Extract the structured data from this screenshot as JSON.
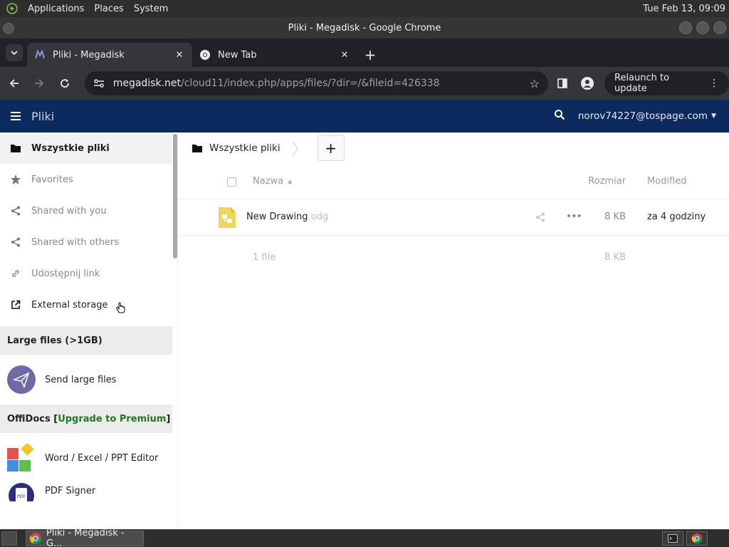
{
  "os_panel": {
    "menus": [
      "Applications",
      "Places",
      "System"
    ],
    "clock": "Tue Feb 13, 09:09"
  },
  "window": {
    "title": "Pliki - Megadisk - Google Chrome"
  },
  "tabs": [
    {
      "title": "Pliki - Megadisk",
      "active": true
    },
    {
      "title": "New Tab",
      "active": false
    }
  ],
  "toolbar": {
    "url_host": "megadisk.net",
    "url_path": "/cloud11/index.php/apps/files/?dir=/&fileid=426338",
    "relaunch_label": "Relaunch to update"
  },
  "app_header": {
    "app_name": "Pliki",
    "user": "norov74227@tospage.com"
  },
  "sidebar": {
    "items": [
      {
        "label": "Wszystkie pliki",
        "icon": "folder-icon"
      },
      {
        "label": "Favorites",
        "icon": "star-icon"
      },
      {
        "label": "Shared with you",
        "icon": "share-icon"
      },
      {
        "label": "Shared with others",
        "icon": "share-icon"
      },
      {
        "label": "Udostępnij link",
        "icon": "link-icon"
      },
      {
        "label": "External storage",
        "icon": "external-link-icon"
      }
    ],
    "large_files": {
      "heading": "Large files (>1GB)",
      "send_label": "Send large files"
    },
    "offidocs": {
      "heading_prefix": "OffiDocs [",
      "premium_link": "Upgrade to Premium",
      "heading_suffix": "]",
      "editor_label": "Word / Excel / PPT Editor",
      "signer_label": "PDF Signer"
    }
  },
  "main": {
    "breadcrumb": "Wszystkie pliki",
    "add_label": "+",
    "columns": {
      "name": "Nazwa",
      "size": "Rozmiar",
      "modified": "Modified"
    },
    "files": [
      {
        "name": "New Drawing",
        "ext": ".odg",
        "size": "8 KB",
        "modified": "za 4 godziny"
      }
    ],
    "summary": {
      "count": "1 file",
      "size": "8 KB"
    }
  },
  "taskbar": {
    "window_label": "Pliki - Megadisk - G..."
  },
  "colors": {
    "header_bg": "#0c2a5d",
    "premium_green": "#1f7a1f",
    "file_icon_yellow": "#f2d45c"
  }
}
